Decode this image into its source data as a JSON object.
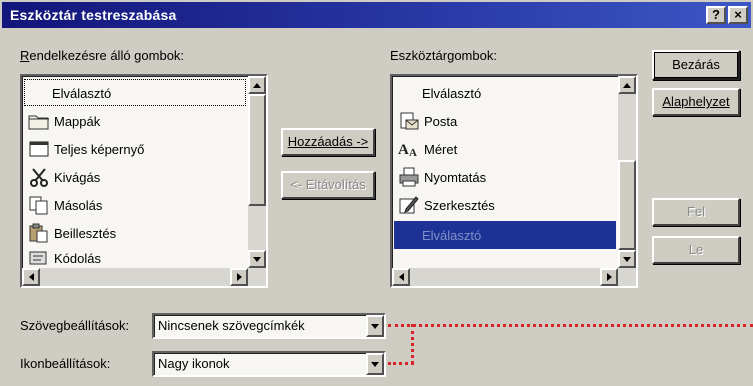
{
  "window": {
    "title": "Eszköztár testreszabása",
    "help_label": "?",
    "close_label": "×"
  },
  "available": {
    "label_prefix": "",
    "label_accel": "R",
    "label_rest": "endelkezésre álló gombok:",
    "items": [
      {
        "label": "Elválasztó",
        "icon": "separator-icon"
      },
      {
        "label": "Mappák",
        "icon": "folders-icon"
      },
      {
        "label": "Teljes képernyő",
        "icon": "fullscreen-icon"
      },
      {
        "label": "Kivágás",
        "icon": "cut-icon"
      },
      {
        "label": "Másolás",
        "icon": "copy-icon"
      },
      {
        "label": "Beillesztés",
        "icon": "paste-icon"
      },
      {
        "label": "Kódolás",
        "icon": "encoding-icon"
      }
    ]
  },
  "toolbar_buttons": {
    "label_prefix": "Eszköztár",
    "label_accel": "g",
    "label_rest": "ombok:",
    "items": [
      {
        "label": "Elválasztó",
        "icon": "separator-icon"
      },
      {
        "label": "Posta",
        "icon": "mail-icon"
      },
      {
        "label": "Méret",
        "icon": "font-size-icon"
      },
      {
        "label": "Nyomtatás",
        "icon": "print-icon"
      },
      {
        "label": "Szerkesztés",
        "icon": "edit-icon"
      },
      {
        "label": "Elválasztó",
        "icon": "separator-icon",
        "selected": true
      }
    ]
  },
  "buttons": {
    "add": "Hozzáadás ->",
    "remove": "<- Eltávolítás",
    "close": "Bezárás",
    "reset": "Alaphelyzet",
    "up": "Fel",
    "down": "Le"
  },
  "text_options": {
    "label": "Szövegbeállítások:",
    "value": "Nincsenek szövegcímkék"
  },
  "icon_options": {
    "label": "Ikonbeállítások:",
    "value": "Nagy ikonok"
  },
  "colors": {
    "titlebar": "#12157a",
    "selection": "#1e3296",
    "dotted_callout": "#d8252a"
  }
}
